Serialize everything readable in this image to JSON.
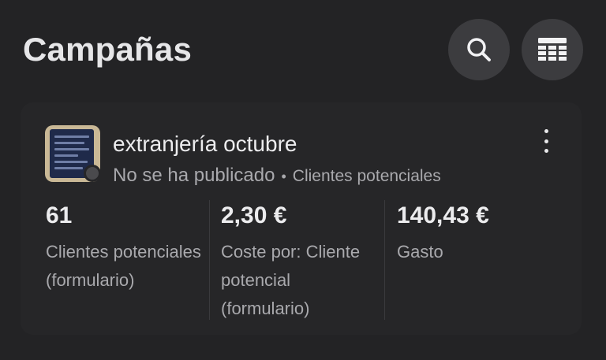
{
  "header": {
    "title": "Campañas",
    "search_icon": "search-icon",
    "table_icon": "table-icon"
  },
  "campaign": {
    "name": "extranjería octubre",
    "status": "No se ha publicado",
    "separator": "•",
    "type": "Clientes potenciales",
    "menu_icon": "more-vertical-icon",
    "metrics": [
      {
        "value": "61",
        "label": "Clientes potenciales (formulario)"
      },
      {
        "value": "2,30 €",
        "label": "Coste por: Cliente potencial (formulario)"
      },
      {
        "value": "140,43 €",
        "label": "Gasto"
      }
    ]
  },
  "colors": {
    "background": "#232325",
    "card": "#262628",
    "button": "#3c3c3f",
    "text_primary": "#ececee",
    "text_secondary": "#a9a9ad"
  }
}
